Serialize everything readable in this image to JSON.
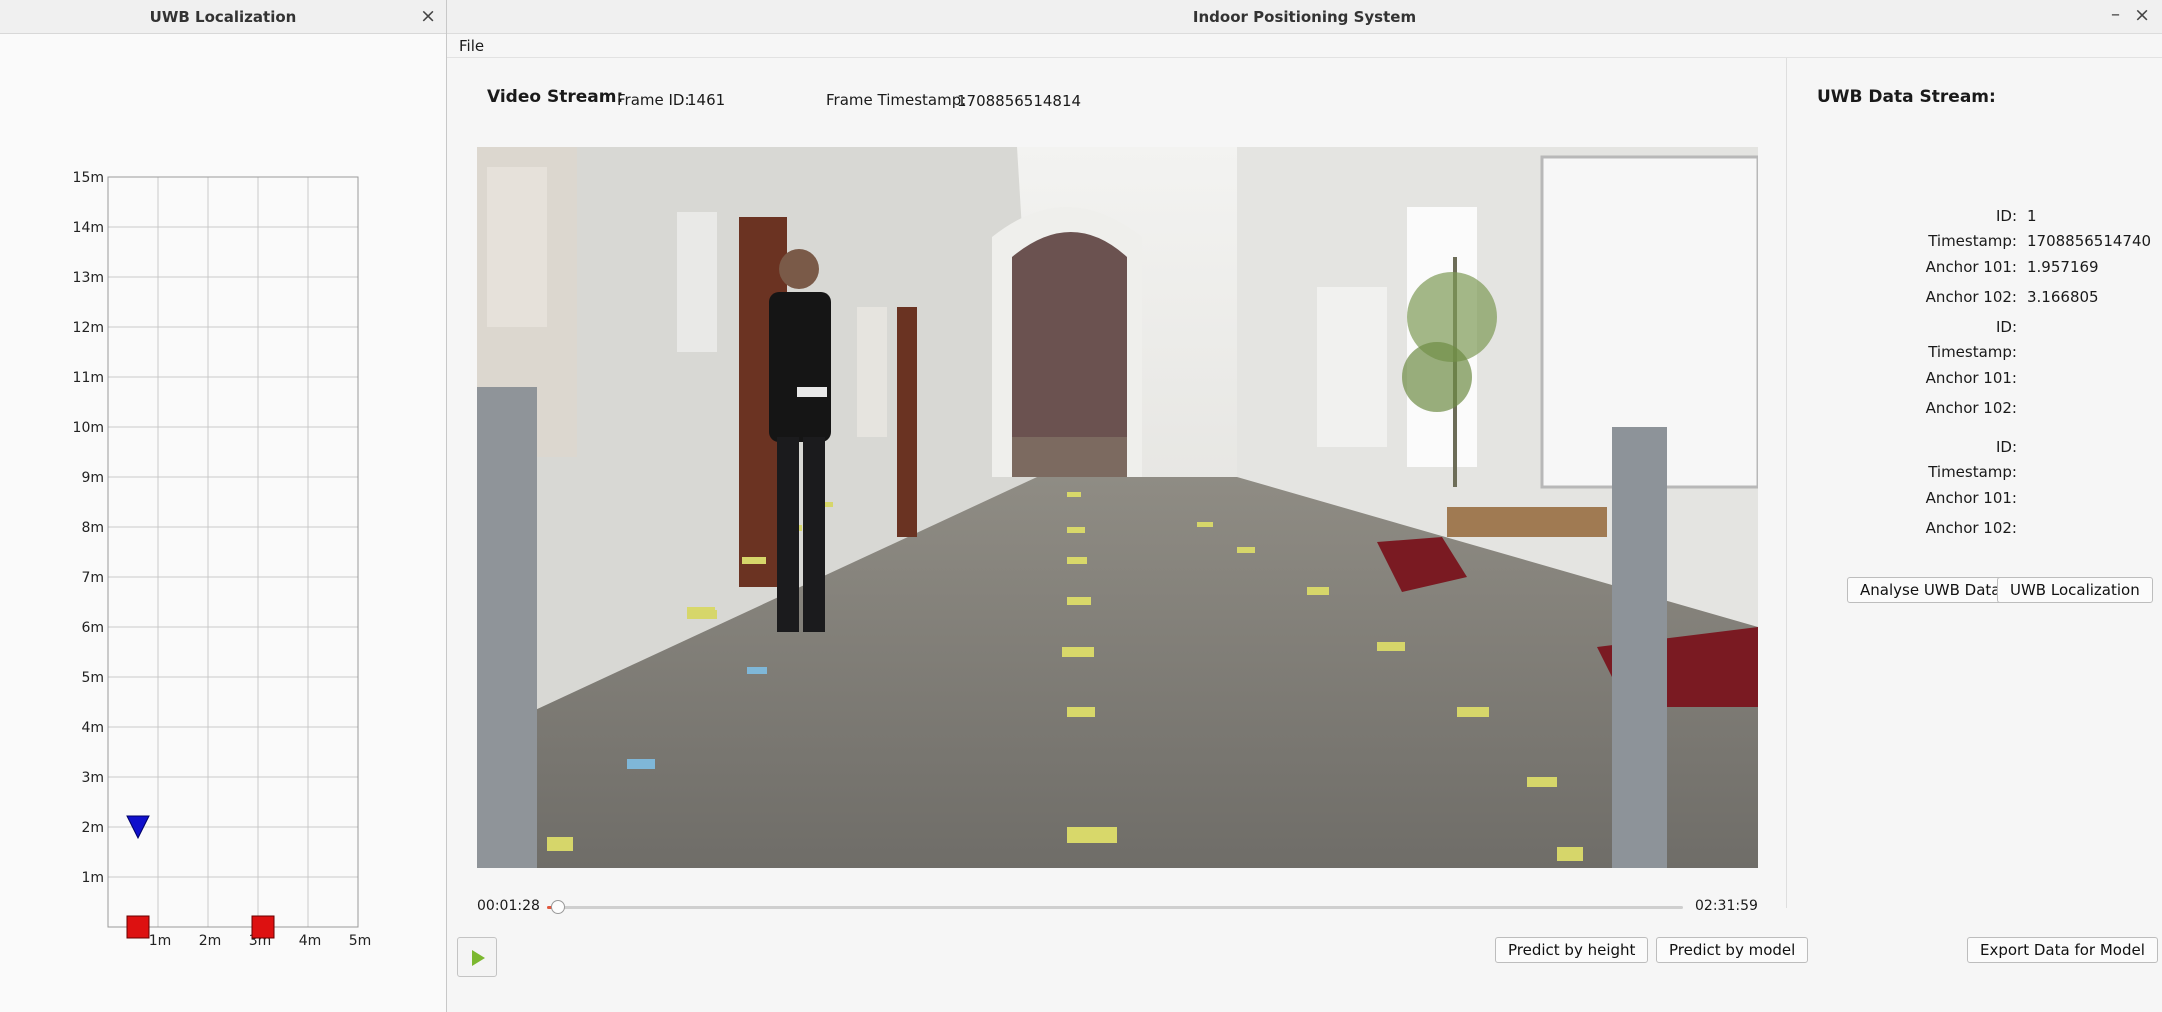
{
  "uwb_window": {
    "title": "UWB Localization",
    "close_glyph": "×",
    "y_ticks": [
      "15m",
      "14m",
      "13m",
      "12m",
      "11m",
      "10m",
      "9m",
      "8m",
      "7m",
      "6m",
      "5m",
      "4m",
      "3m",
      "2m",
      "1m"
    ],
    "x_ticks": [
      "1m",
      "2m",
      "3m",
      "4m",
      "5m"
    ],
    "tag_position_m": {
      "x": 0.6,
      "y": 2.0
    },
    "anchors_m": [
      {
        "x": 0.6,
        "y": 0
      },
      {
        "x": 3.1,
        "y": 0
      }
    ],
    "colors": {
      "tag": "#1010cc",
      "anchor": "#dd1111",
      "grid": "#c9c9c9"
    }
  },
  "main_window": {
    "title": "Indoor Positioning System",
    "minimize_glyph": "–",
    "close_glyph": "×",
    "menu": {
      "file": "File"
    },
    "video": {
      "stream_label": "Video Stream:",
      "frame_id_label": "Frame ID:",
      "frame_id": "1461",
      "frame_ts_label": "Frame Timestamp:",
      "frame_ts": "1708856514814",
      "current_time": "00:01:28",
      "total_time": "02:31:59",
      "progress": 0.0096
    },
    "buttons": {
      "predict_height": "Predict by height",
      "predict_model": "Predict by model",
      "export": "Export Data for Model",
      "analyse": "Analyse UWB Data",
      "localization": "UWB Localization"
    },
    "uwb_stream": {
      "title": "UWB Data Stream:",
      "records": [
        {
          "id_label": "ID:",
          "id": "1",
          "ts_label": "Timestamp:",
          "ts": "1708856514740",
          "a101_label": "Anchor 101:",
          "a101": "1.957169",
          "a102_label": "Anchor 102:",
          "a102": "3.166805"
        },
        {
          "id_label": "ID:",
          "id": "",
          "ts_label": "Timestamp:",
          "ts": "",
          "a101_label": "Anchor 101:",
          "a101": "",
          "a102_label": "Anchor 102:",
          "a102": ""
        },
        {
          "id_label": "ID:",
          "id": "",
          "ts_label": "Timestamp:",
          "ts": "",
          "a101_label": "Anchor 101:",
          "a101": "",
          "a102_label": "Anchor 102:",
          "a102": ""
        }
      ]
    },
    "colors": {
      "progress": "#e2583e",
      "play_icon": "#7cb82f"
    }
  }
}
